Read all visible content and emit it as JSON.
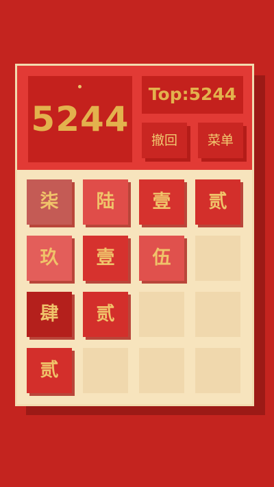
{
  "score": {
    "value": "5244"
  },
  "top": {
    "label": "Top:5244"
  },
  "buttons": {
    "undo_label": "撤回",
    "menu_label": "菜单"
  },
  "colors": {
    "background": "#c4241f",
    "board": "#f7e4bd",
    "header": "#e23a35",
    "text_gold": "#e3b24d"
  },
  "tiles": [
    {
      "label": "柒",
      "row": 0,
      "col": 0,
      "color": "#c45b55"
    },
    {
      "label": "陆",
      "row": 0,
      "col": 1,
      "color": "#e04d49"
    },
    {
      "label": "壹",
      "row": 0,
      "col": 2,
      "color": "#d6322e"
    },
    {
      "label": "贰",
      "row": 0,
      "col": 3,
      "color": "#d32f2b"
    },
    {
      "label": "玖",
      "row": 1,
      "col": 0,
      "color": "#e35e5a"
    },
    {
      "label": "壹",
      "row": 1,
      "col": 1,
      "color": "#d6322e"
    },
    {
      "label": "伍",
      "row": 1,
      "col": 2,
      "color": "#e0514d"
    },
    {
      "label": "肆",
      "row": 2,
      "col": 0,
      "color": "#b4201c"
    },
    {
      "label": "贰",
      "row": 2,
      "col": 1,
      "color": "#d32f2b"
    },
    {
      "label": "贰",
      "row": 3,
      "col": 0,
      "color": "#d32f2b"
    }
  ]
}
